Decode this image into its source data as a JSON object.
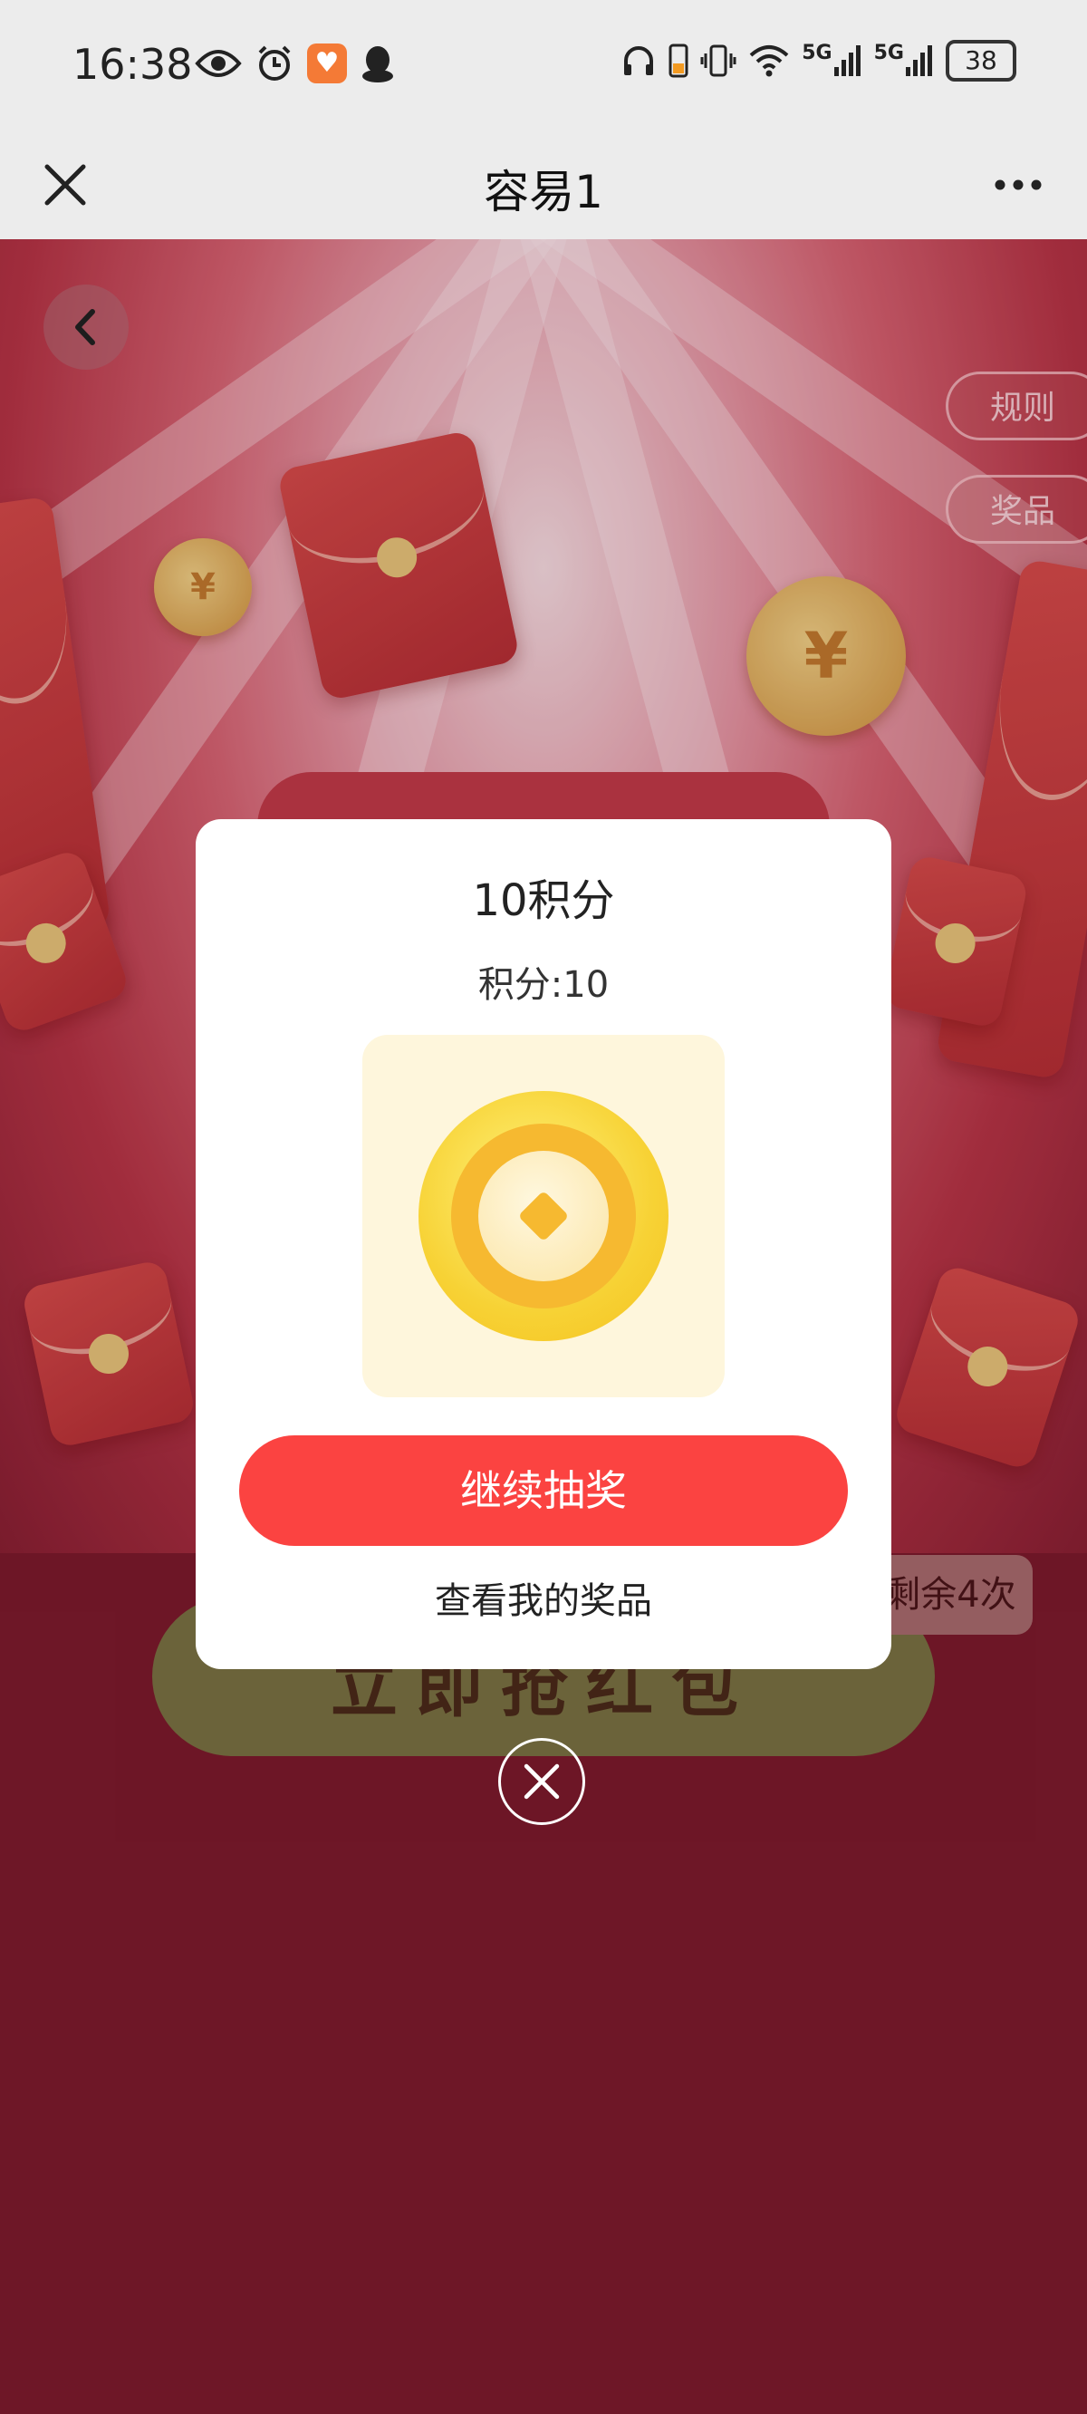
{
  "status_bar": {
    "time": "16:38",
    "left_icons": [
      "eye-icon",
      "alarm-icon",
      "app-badge-icon",
      "qq-icon"
    ],
    "right_icons": [
      "headphones-icon",
      "battery-saver-icon",
      "vibrate-icon",
      "wifi-icon",
      "signal-5g-icon",
      "signal-5g-icon"
    ],
    "network_label": "5G",
    "battery": "38"
  },
  "title_bar": {
    "title": "容易1",
    "close_icon": "close-icon",
    "more_icon": "more-icon"
  },
  "page": {
    "rules_label": "规则",
    "prizes_label": "奖品",
    "grab_button_label": "立即抢红包",
    "remaining_label": "剩余4次"
  },
  "modal": {
    "title": "10积分",
    "points_text": "积分:10",
    "continue_button": "继续抽奖",
    "view_prizes_link": "查看我的奖品"
  },
  "colors": {
    "accent_red": "#fb4341",
    "background": "#7d1a2c",
    "coin_yellow": "#f7d235"
  }
}
